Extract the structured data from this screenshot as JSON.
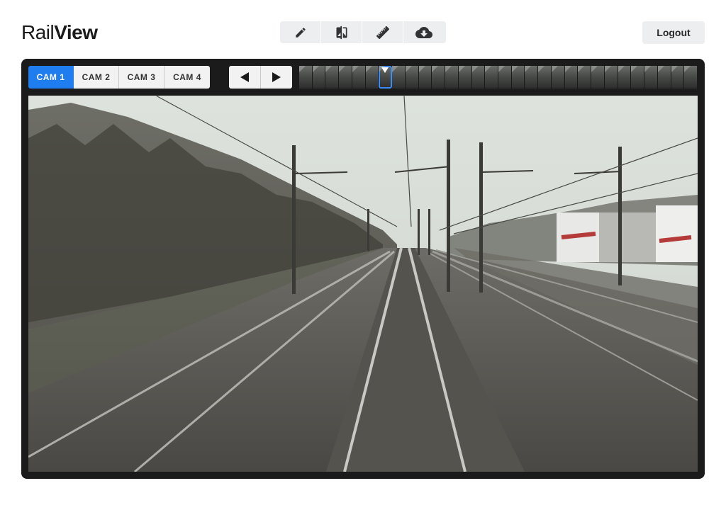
{
  "app": {
    "logo_light": "Rail",
    "logo_bold": "View"
  },
  "toolbar": {
    "tools": [
      {
        "name": "pencil-icon",
        "label": "Edit"
      },
      {
        "name": "compare-icon",
        "label": "Compare"
      },
      {
        "name": "ruler-icon",
        "label": "Measure"
      },
      {
        "name": "cloud-download-icon",
        "label": "Download"
      }
    ]
  },
  "header": {
    "logout_label": "Logout"
  },
  "cameras": {
    "tabs": [
      "CAM 1",
      "CAM 2",
      "CAM 3",
      "CAM 4"
    ],
    "active": "CAM 1"
  },
  "navigation": {
    "prev_icon": "triangle-left-icon",
    "next_icon": "triangle-right-icon"
  },
  "timeline": {
    "frame_count": 30,
    "selected_frame": 6
  },
  "colors": {
    "accent": "#1f7df0",
    "viewer_bg": "#1b1b1b",
    "button_bg": "#eceef0"
  }
}
